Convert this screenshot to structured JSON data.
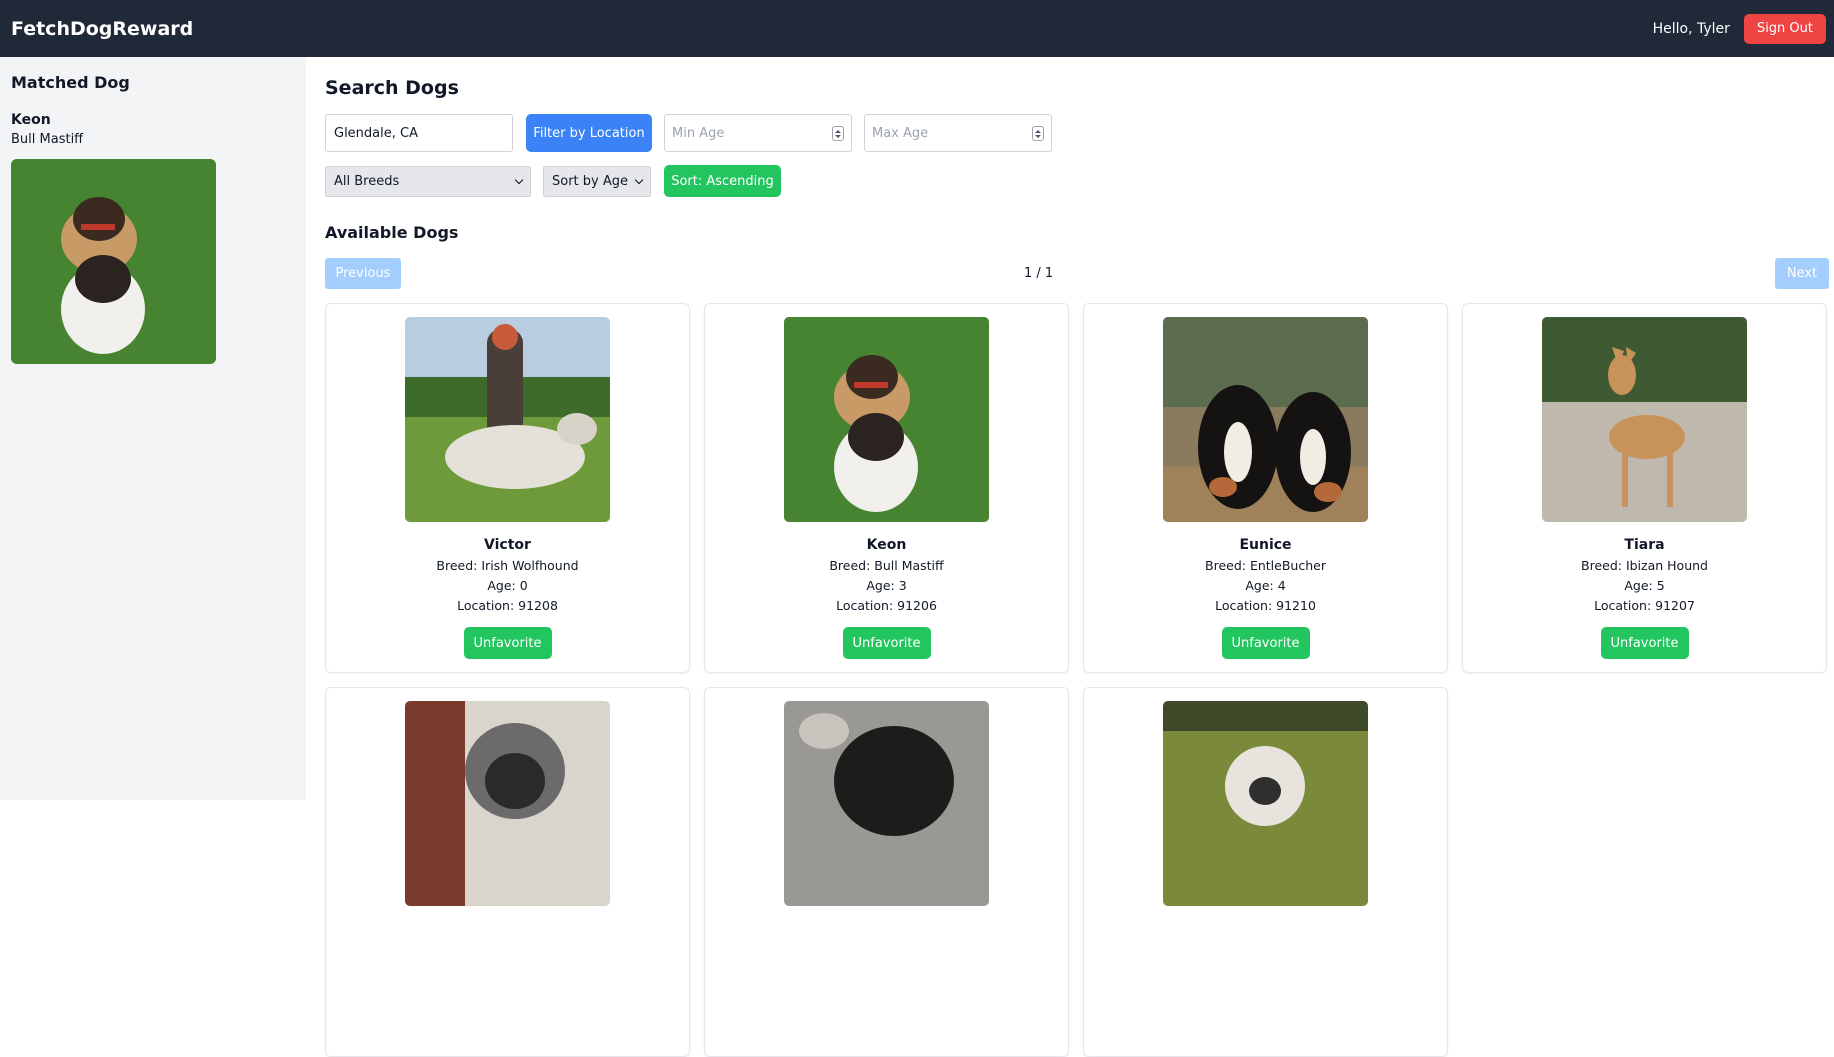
{
  "header": {
    "brand": "FetchDogReward",
    "greeting": "Hello, Tyler",
    "signout_label": "Sign Out"
  },
  "sidebar": {
    "title": "Matched Dog",
    "match": {
      "name": "Keon",
      "breed": "Bull Mastiff"
    }
  },
  "search": {
    "title": "Search Dogs",
    "location_value": "Glendale, CA",
    "filter_label": "Filter by Location",
    "min_age_placeholder": "Min Age",
    "max_age_placeholder": "Max Age",
    "breed_selected": "All Breeds",
    "sort_by_selected": "Sort by Age",
    "sort_order_label": "Sort: Ascending"
  },
  "available": {
    "title": "Available Dogs",
    "previous_label": "Previous",
    "next_label": "Next",
    "page_indicator": "1 / 1"
  },
  "dogs": [
    {
      "name": "Victor",
      "breed": "Breed: Irish Wolfhound",
      "age": "Age: 0",
      "location": "Location: 91208",
      "action": "Unfavorite"
    },
    {
      "name": "Keon",
      "breed": "Breed: Bull Mastiff",
      "age": "Age: 3",
      "location": "Location: 91206",
      "action": "Unfavorite"
    },
    {
      "name": "Eunice",
      "breed": "Breed: EntleBucher",
      "age": "Age: 4",
      "location": "Location: 91210",
      "action": "Unfavorite"
    },
    {
      "name": "Tiara",
      "breed": "Breed: Ibizan Hound",
      "age": "Age: 5",
      "location": "Location: 91207",
      "action": "Unfavorite"
    }
  ],
  "colors": {
    "header_bg": "#1f2937",
    "signout": "#ef4444",
    "primary": "#3b82f6",
    "success": "#22c55e",
    "sidebar_bg": "#f3f4f6"
  }
}
